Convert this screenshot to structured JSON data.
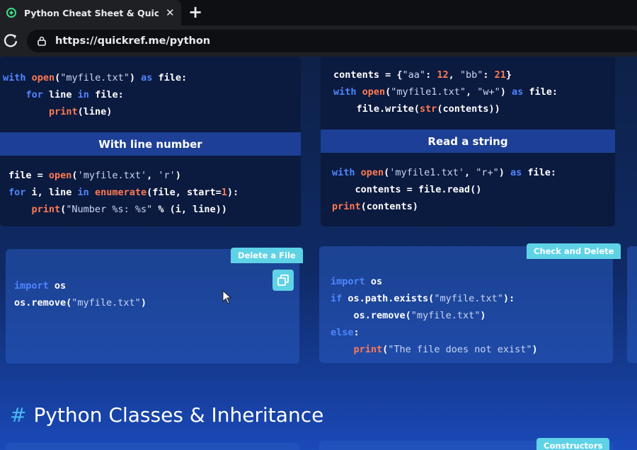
{
  "browser": {
    "tab_title": "Python Cheat Sheet & Quick Refe",
    "url": "https://quickref.me/python",
    "new_tab_label": "+",
    "close_label": "✕"
  },
  "cards": {
    "top_left_code": [
      [
        [
          "kw",
          "with "
        ],
        [
          "fn",
          "open"
        ],
        [
          "op",
          "("
        ],
        [
          "str",
          "\"myfile.txt\""
        ],
        [
          "op",
          ") "
        ],
        [
          "kw",
          "as "
        ],
        [
          "op",
          "file:"
        ]
      ],
      [
        [
          "op",
          "    "
        ],
        [
          "kw",
          "for "
        ],
        [
          "op",
          "line "
        ],
        [
          "kw",
          "in "
        ],
        [
          "op",
          "file:"
        ]
      ],
      [
        [
          "op",
          "        "
        ],
        [
          "fn",
          "print"
        ],
        [
          "op",
          "(line)"
        ]
      ]
    ],
    "top_right_code": [
      [
        [
          "op",
          "contents = {"
        ],
        [
          "str",
          "\"aa\""
        ],
        [
          "op",
          ": "
        ],
        [
          "num",
          "12"
        ],
        [
          "op",
          ", "
        ],
        [
          "str",
          "\"bb\""
        ],
        [
          "op",
          ": "
        ],
        [
          "num",
          "21"
        ],
        [
          "op",
          "}"
        ]
      ],
      [
        [
          "kw",
          "with "
        ],
        [
          "fn",
          "open"
        ],
        [
          "op",
          "("
        ],
        [
          "str",
          "\"myfile1.txt\""
        ],
        [
          "op",
          ", "
        ],
        [
          "str",
          "\"w+\""
        ],
        [
          "op",
          ") "
        ],
        [
          "kw",
          "as "
        ],
        [
          "op",
          "file:"
        ]
      ],
      [
        [
          "op",
          "    file.write("
        ],
        [
          "fn",
          "str"
        ],
        [
          "op",
          "(contents))"
        ]
      ]
    ],
    "line_number_heading": "With line number",
    "line_number_code": [
      [
        [
          "op",
          "file = "
        ],
        [
          "fn",
          "open"
        ],
        [
          "op",
          "("
        ],
        [
          "str",
          "'myfile.txt'"
        ],
        [
          "op",
          ", "
        ],
        [
          "str",
          "'r'"
        ],
        [
          "op",
          ")"
        ]
      ],
      [
        [
          "kw",
          "for "
        ],
        [
          "op",
          "i, line "
        ],
        [
          "kw",
          "in "
        ],
        [
          "fn",
          "enumerate"
        ],
        [
          "op",
          "(file, start="
        ],
        [
          "num",
          "1"
        ],
        [
          "op",
          "):"
        ]
      ],
      [
        [
          "op",
          "    "
        ],
        [
          "fn",
          "print"
        ],
        [
          "op",
          "("
        ],
        [
          "str",
          "\"Number %s: %s\""
        ],
        [
          "op",
          " % (i, line))"
        ]
      ]
    ],
    "read_string_heading": "Read a string",
    "read_string_code": [
      [
        [
          "kw",
          "with "
        ],
        [
          "fn",
          "open"
        ],
        [
          "op",
          "("
        ],
        [
          "str",
          "'myfile1.txt'"
        ],
        [
          "op",
          ", "
        ],
        [
          "str",
          "\"r+\""
        ],
        [
          "op",
          ") "
        ],
        [
          "kw",
          "as "
        ],
        [
          "op",
          "file:"
        ]
      ],
      [
        [
          "op",
          "    contents = file.read()"
        ]
      ],
      [
        [
          "fn",
          "print"
        ],
        [
          "op",
          "(contents)"
        ]
      ]
    ],
    "delete_badge": "Delete a File",
    "delete_code": [
      [
        [
          "kw",
          "import "
        ],
        [
          "op",
          "os"
        ]
      ],
      [
        [
          "op",
          "os.remove("
        ],
        [
          "str",
          "\"myfile.txt\""
        ],
        [
          "op",
          ")"
        ]
      ]
    ],
    "check_badge": "Check and Delete",
    "check_code": [
      [
        [
          "kw",
          "import "
        ],
        [
          "op",
          "os"
        ]
      ],
      [
        [
          "kw",
          "if "
        ],
        [
          "op",
          "os.path.exists("
        ],
        [
          "str",
          "\"myfile.txt\""
        ],
        [
          "op",
          "):"
        ]
      ],
      [
        [
          "op",
          "    os.remove("
        ],
        [
          "str",
          "\"myfile.txt\""
        ],
        [
          "op",
          ")"
        ]
      ],
      [
        [
          "kw",
          "else"
        ],
        [
          "op",
          ":"
        ]
      ],
      [
        [
          "op",
          "    "
        ],
        [
          "fn",
          "print"
        ],
        [
          "op",
          "("
        ],
        [
          "str",
          "\"The file does not exist\""
        ],
        [
          "op",
          ")"
        ]
      ]
    ],
    "constructors_badge": "Constructors"
  },
  "section": {
    "hash": "#",
    "title": "Python Classes & Inheritance"
  },
  "colors": {
    "keyword": "#4e86ff",
    "function": "#ff7a52",
    "badge": "#5fd3e6",
    "accent_hash": "#48b7f0"
  }
}
